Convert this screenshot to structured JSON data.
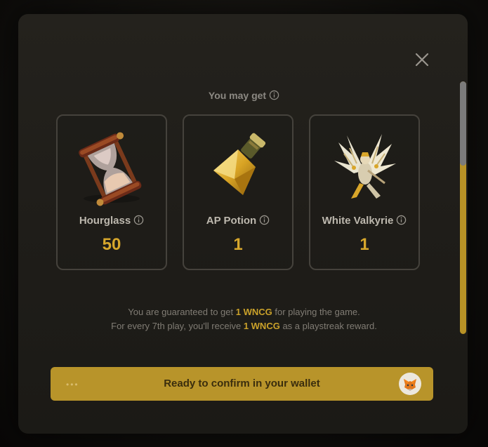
{
  "modal": {
    "subtitle": "You may get",
    "rewards": [
      {
        "name": "Hourglass",
        "quantity": "50",
        "icon": "hourglass-icon"
      },
      {
        "name": "AP Potion",
        "quantity": "1",
        "icon": "potion-icon"
      },
      {
        "name": "White Valkyrie",
        "quantity": "1",
        "icon": "valkyrie-icon"
      }
    ],
    "info_line1": {
      "before": "You are guaranteed to get",
      "highlight": "1 WNCG",
      "after": "for playing the game."
    },
    "info_line2": {
      "before": "For every 7th play, you'll receive",
      "highlight": "1 WNCG",
      "after": "as a playstreak reward."
    },
    "confirm_label": "Ready to confirm in your wallet",
    "confirm_dots": "•••",
    "wallet_icon": "metamask-fox-icon"
  },
  "colors": {
    "accent": "#d7a72c",
    "button": "#b8942a",
    "scrollbar": "#b89226"
  }
}
